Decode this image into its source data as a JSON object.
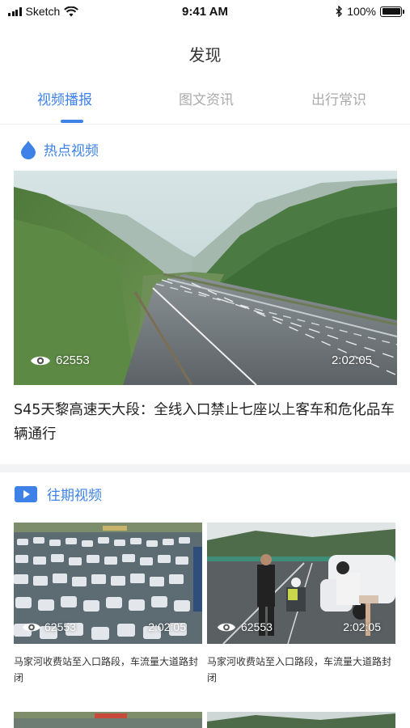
{
  "status_bar": {
    "carrier": "Sketch",
    "time": "9:41 AM",
    "battery": "100%"
  },
  "header": {
    "title": "发现"
  },
  "tabs": [
    {
      "label": "视频播报",
      "active": true
    },
    {
      "label": "图文资讯",
      "active": false
    },
    {
      "label": "出行常识",
      "active": false
    }
  ],
  "hot_section": {
    "title": "热点视频",
    "icon": "drop-icon",
    "video": {
      "views": "62553",
      "duration": "2:02:05",
      "title": "S45天黎高速天大段：全线入口禁止七座以上客车和危化品车辆通行"
    }
  },
  "past_section": {
    "title": "往期视频",
    "icon": "play-icon",
    "items": [
      {
        "views": "62553",
        "duration": "2:02:05",
        "caption": "马家河收费站至入口路段，车流量大道路封闭"
      },
      {
        "views": "62553",
        "duration": "2:02:05",
        "caption": "马家河收费站至入口路段，车流量大道路封闭"
      }
    ]
  },
  "colors": {
    "accent": "#3e82e8",
    "tab_inactive": "#aaaaaa",
    "divider": "#f2f3f5"
  }
}
